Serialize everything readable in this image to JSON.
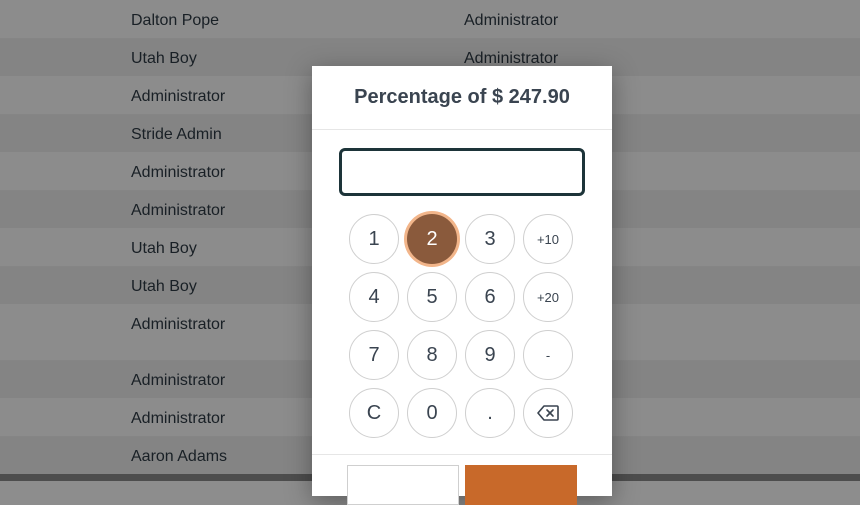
{
  "table": {
    "rows": [
      {
        "name": "Dalton Pope",
        "role": "Administrator"
      },
      {
        "name": "Utah Boy",
        "role": "Administrator"
      },
      {
        "name": "Administrator",
        "role": ""
      },
      {
        "name": "Stride Admin",
        "role": ""
      },
      {
        "name": "Administrator",
        "role": ""
      },
      {
        "name": "Administrator",
        "role": ""
      },
      {
        "name": "Utah Boy",
        "role": ""
      },
      {
        "name": "Utah Boy",
        "role": ""
      },
      {
        "name": "Administrator",
        "role": ""
      },
      {
        "name": "Administrator",
        "role": ""
      },
      {
        "name": "Administrator",
        "role": ""
      },
      {
        "name": "Aaron Adams",
        "role": ""
      }
    ]
  },
  "modal": {
    "title": "Percentage of $ 247.90",
    "input_value": "",
    "keys": [
      "1",
      "2",
      "3",
      "+10",
      "4",
      "5",
      "6",
      "+20",
      "7",
      "8",
      "9",
      "-",
      "C",
      "0",
      ".",
      "⌫"
    ],
    "active_key": "2",
    "cancel_label": "",
    "confirm_label": ""
  },
  "colors": {
    "accent": "#c8692a",
    "active_key": "#8a5a3c",
    "input_border": "#1d3439"
  }
}
